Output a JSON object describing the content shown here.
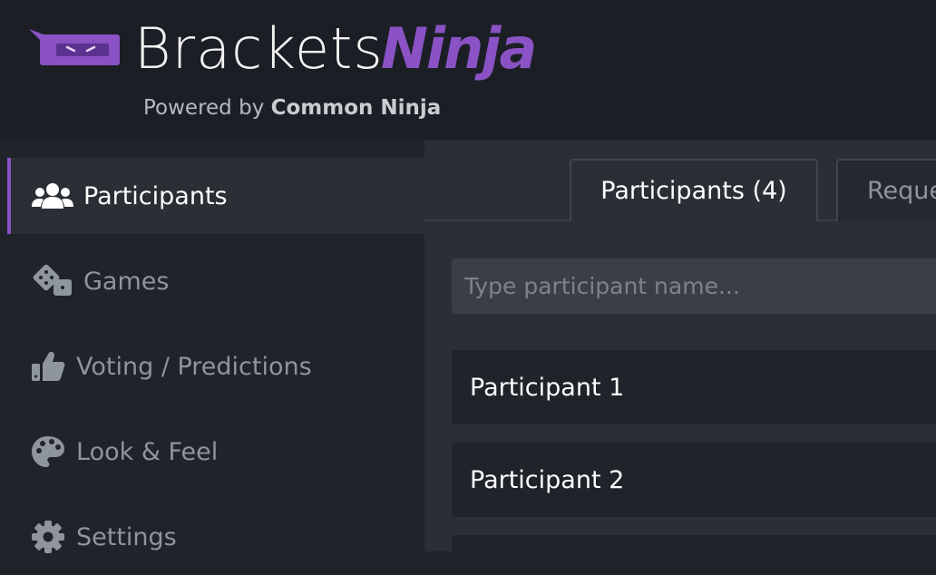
{
  "header": {
    "logo_primary": "Brackets",
    "logo_secondary": "Ninja",
    "powered_prefix": "Powered by",
    "powered_brand": "Common Ninja"
  },
  "sidebar": {
    "items": [
      {
        "label": "Participants",
        "icon": "users-icon",
        "active": true
      },
      {
        "label": "Games",
        "icon": "dice-icon",
        "active": false
      },
      {
        "label": "Voting / Predictions",
        "icon": "thumbs-up-icon",
        "active": false
      },
      {
        "label": "Look & Feel",
        "icon": "palette-icon",
        "active": false
      },
      {
        "label": "Settings",
        "icon": "gear-icon",
        "active": false
      }
    ]
  },
  "main": {
    "tabs": [
      {
        "label": "Participants (4)",
        "active": true
      },
      {
        "label": "Reque",
        "active": false
      }
    ],
    "search": {
      "placeholder": "Type participant name...",
      "value": ""
    },
    "participants": [
      "Participant 1",
      "Participant 2"
    ]
  },
  "colors": {
    "accent": "#8a52c4",
    "header_bg": "#1b1f25",
    "sidebar_bg": "#1f232a",
    "main_bg": "#2a2e35"
  }
}
